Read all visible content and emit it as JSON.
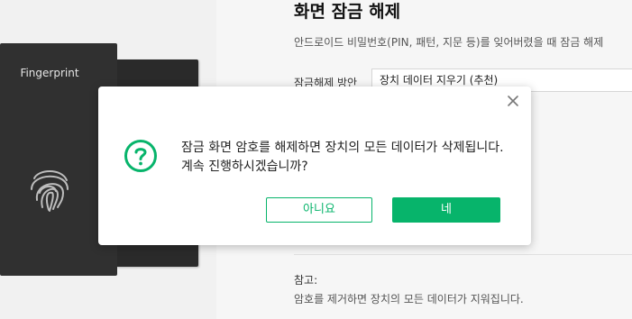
{
  "colors": {
    "accent": "#07b46b",
    "phone_dark": "#303030",
    "background": "#f6f6f6"
  },
  "background_page": {
    "title": "화면 잠금 해제",
    "subtitle": "안드로이드 비밀번호(PIN, 패턴, 지문 등)를 잊어버렸을 때 잠금 해제",
    "method_label": "잠금해제 방안",
    "method_value": "장치 데이터 지우기 (추천)",
    "note_title": "참고:",
    "note_body": "암호를 제거하면 장치의 모든 데이터가 지워집니다."
  },
  "illustration": {
    "phone_title": "Fingerprint",
    "icon": "fingerprint-icon"
  },
  "dialog": {
    "icon": "question-circle-icon",
    "close_icon": "close-icon",
    "message": "잠금 화면 암호를 해제하면 장치의 모든 데이터가 삭제됩니다. 계속 진행하시겠습니까?",
    "no_label": "아니요",
    "yes_label": "네"
  }
}
